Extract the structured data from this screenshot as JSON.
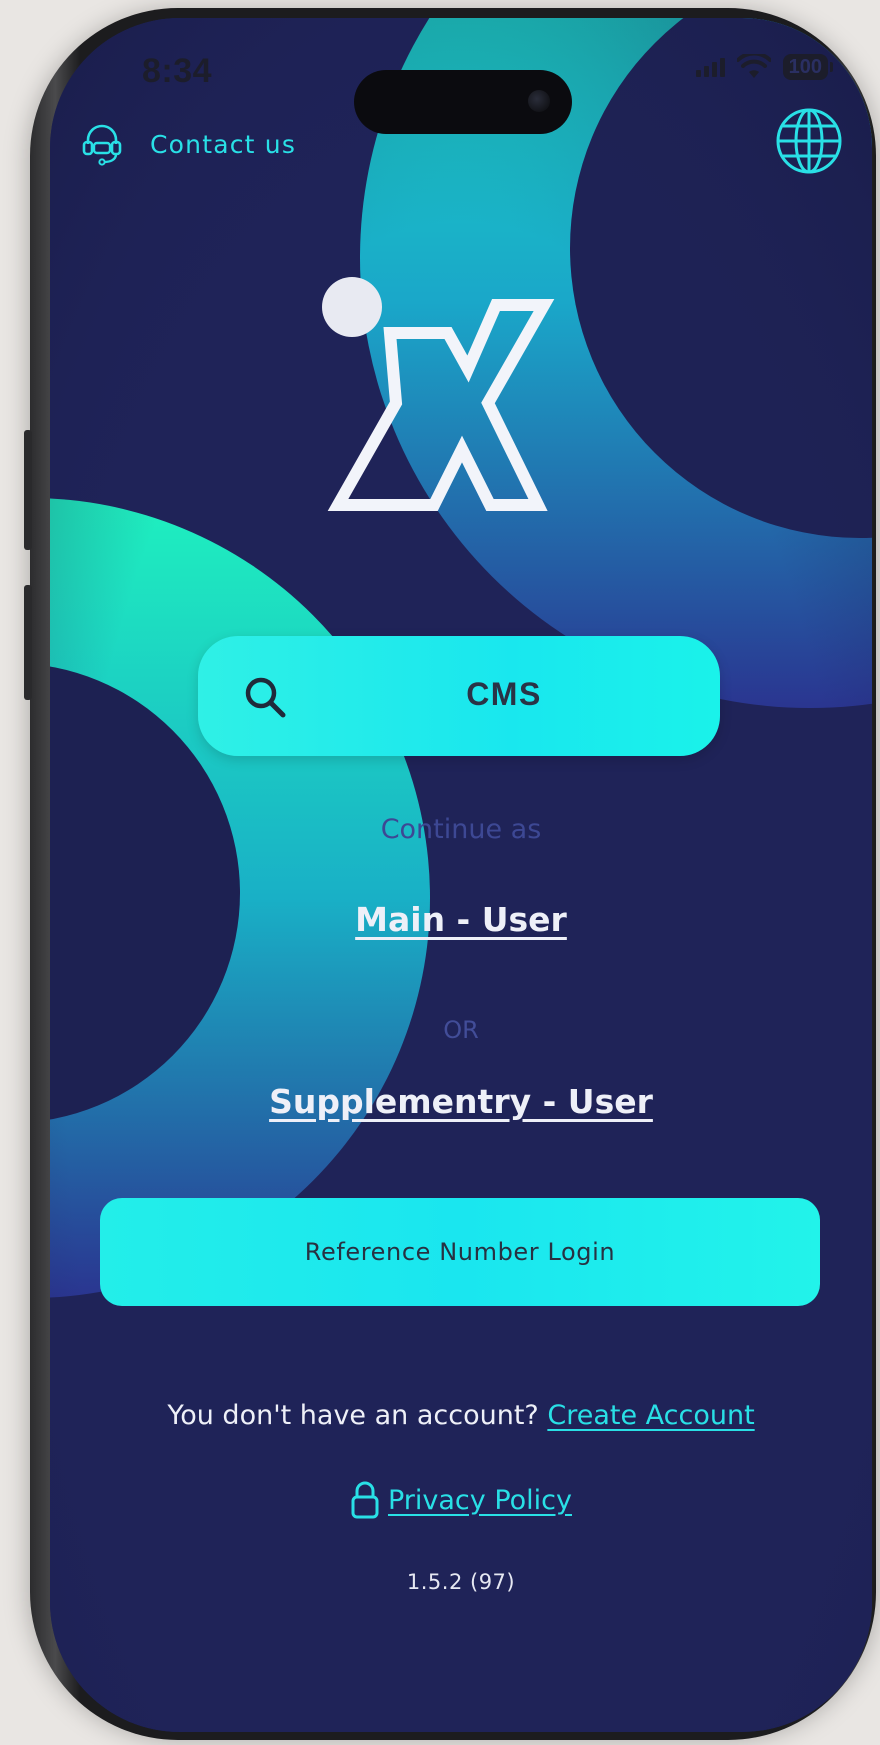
{
  "status_bar": {
    "time": "8:34",
    "battery": "100"
  },
  "header": {
    "contact_label": "Contact us",
    "language_icon": "globe-icon",
    "support_icon": "headset-icon"
  },
  "search": {
    "value": "CMS",
    "icon": "search-icon"
  },
  "login": {
    "continue_as": "Continue as",
    "main_user": "Main - User",
    "or": "OR",
    "supplementary_user": "Supplementry - User",
    "reference_button": "Reference Number Login"
  },
  "footer": {
    "no_account_text": "You don't have an account?",
    "create_account": "Create Account",
    "privacy_policy": "Privacy Policy",
    "lock_icon": "lock-icon",
    "version": "1.5.2 (97)"
  },
  "colors": {
    "background": "#1f2358",
    "accent": "#29e0e6",
    "button": "#1ae6ef"
  }
}
